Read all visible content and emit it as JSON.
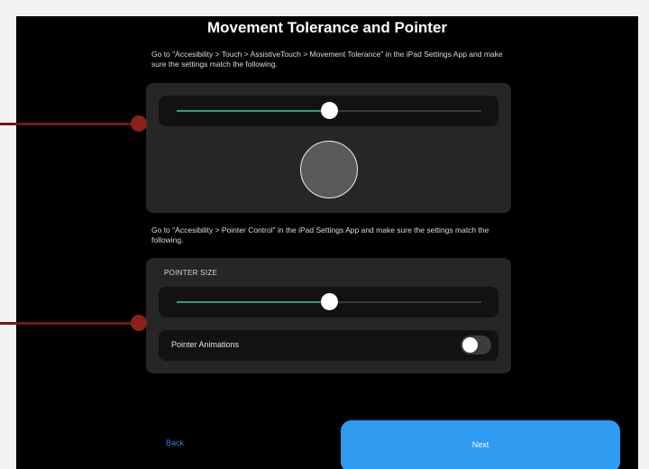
{
  "title": "Movement Tolerance and Pointer",
  "movement": {
    "instruction": "Go to \"Accesibility > Touch > AssistiveTouch > Movement Tolerance\" in the iPad Settings App and make sure the settings match the following.",
    "slider_value_pct": 50
  },
  "pointer": {
    "instruction": "Go to \"Accesibility > Pointer Control\" in the iPad Settings App and make sure the settings match the following.",
    "size_label": "POINTER SIZE",
    "size_value_pct": 50,
    "animations_label": "Pointer Animations",
    "animations_on": false
  },
  "buttons": {
    "back": "Back",
    "next": "Next"
  },
  "colors": {
    "accent": "#2e9bf0",
    "slider_fill": "#2f9c7e",
    "annotation": "#8b2219"
  }
}
